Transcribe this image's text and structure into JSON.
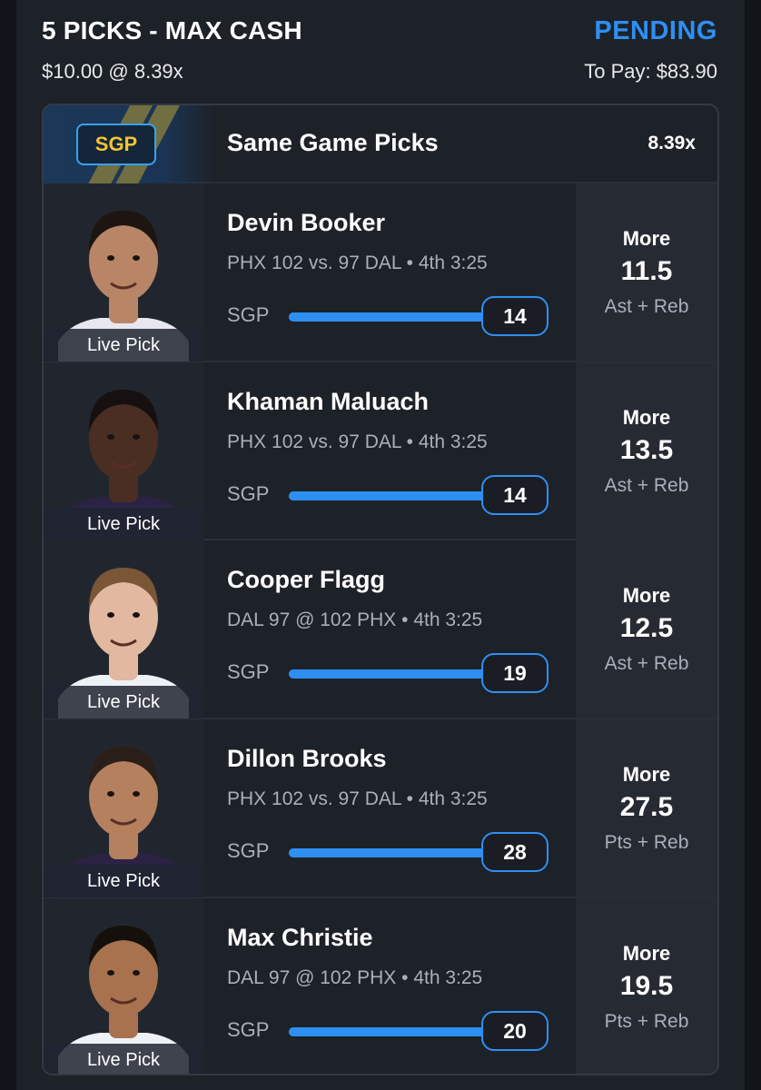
{
  "header": {
    "title": "5 PICKS - MAX CASH",
    "status": "PENDING",
    "stake": "$10.00 @ 8.39x",
    "to_pay": "To Pay: $83.90"
  },
  "card": {
    "badge": "SGP",
    "title": "Same Game Picks",
    "multiplier": "8.39x"
  },
  "colors": {
    "accent": "#2e8ff2",
    "badge_text": "#f4c430",
    "background": "#1d2128"
  },
  "picks": [
    {
      "name": "Devin Booker",
      "game": "PHX 102 vs. 97 DAL • 4th 3:25",
      "tag": "Live Pick",
      "sgp_label": "SGP",
      "current": "14",
      "progress": 1.0,
      "direction": "More",
      "line": "11.5",
      "stat": "Ast + Reb",
      "skin": "#b88566",
      "hair": "#1c1512",
      "jersey": "#e8e6ee"
    },
    {
      "name": "Khaman Maluach",
      "game": "PHX 102 vs. 97 DAL • 4th 3:25",
      "tag": "Live Pick",
      "sgp_label": "SGP",
      "current": "14",
      "progress": 1.0,
      "direction": "More",
      "line": "13.5",
      "stat": "Ast + Reb",
      "skin": "#4a2e22",
      "hair": "#161010",
      "jersey": "#2b2244"
    },
    {
      "name": "Cooper Flagg",
      "game": "DAL 97 @ 102 PHX • 4th 3:25",
      "tag": "Live Pick",
      "sgp_label": "SGP",
      "current": "19",
      "progress": 1.0,
      "direction": "More",
      "line": "12.5",
      "stat": "Ast + Reb",
      "skin": "#e2b8a0",
      "hair": "#7a5636",
      "jersey": "#eef2f6"
    },
    {
      "name": "Dillon Brooks",
      "game": "PHX 102 vs. 97 DAL • 4th 3:25",
      "tag": "Live Pick",
      "sgp_label": "SGP",
      "current": "28",
      "progress": 1.0,
      "direction": "More",
      "line": "27.5",
      "stat": "Pts + Reb",
      "skin": "#b4805e",
      "hair": "#2a1e18",
      "jersey": "#2b2244"
    },
    {
      "name": "Max Christie",
      "game": "DAL 97 @ 102 PHX • 4th 3:25",
      "tag": "Live Pick",
      "sgp_label": "SGP",
      "current": "20",
      "progress": 1.0,
      "direction": "More",
      "line": "19.5",
      "stat": "Pts + Reb",
      "skin": "#a8724f",
      "hair": "#15100c",
      "jersey": "#eef2f6"
    }
  ]
}
